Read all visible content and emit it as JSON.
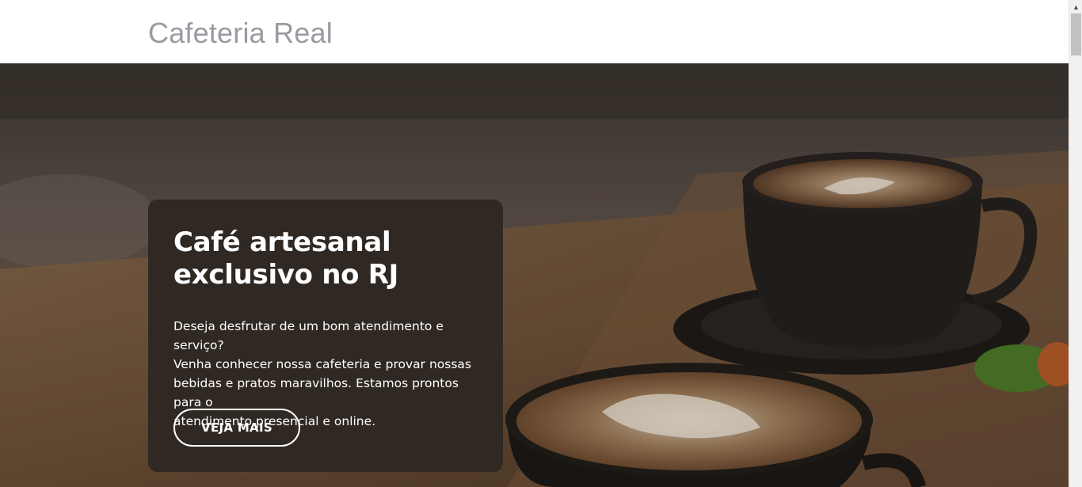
{
  "header": {
    "brand": "Cafeteria Real"
  },
  "hero": {
    "image_alt": "cups-of-coffee-icon",
    "title_line1": "Café artesanal",
    "title_line2": "exclusivo no RJ",
    "text_line1": "Deseja desfrutar de um bom atendimento e serviço?",
    "text_line2": "Venha conhecer nossa cafeteria e provar nossas",
    "text_line3": "bebidas e pratos maravilhos. Estamos prontos para o",
    "text_line4": "atendimento presencial e online.",
    "cta_label": "VEJA MAIS"
  },
  "scrollbar": {
    "up_arrow": "▲"
  },
  "colors": {
    "card_bg": "#302923",
    "brand_text": "#9a9aa2",
    "hero_text": "#ffffff"
  }
}
